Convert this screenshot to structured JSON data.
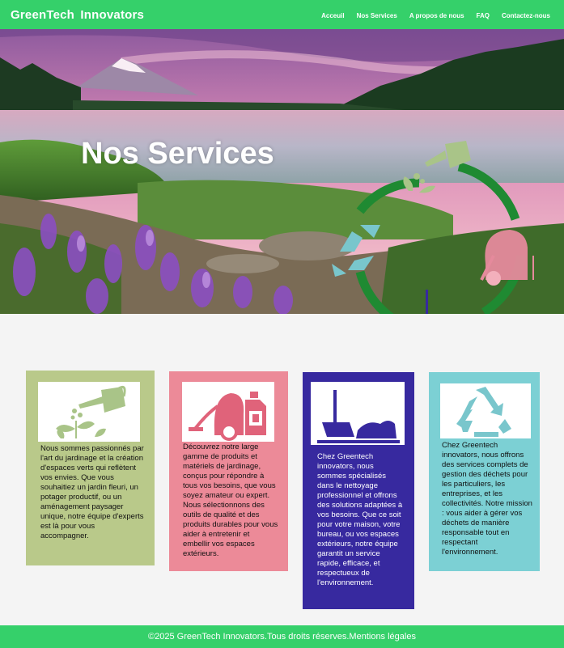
{
  "header": {
    "brand": "GreenTech  Innovators",
    "nav": [
      "Acceuil",
      "Nos Services",
      "A propos de nous",
      "FAQ",
      "Contactez-nous"
    ]
  },
  "hero": {
    "title": "Nos Services"
  },
  "cards": [
    {
      "icon": "watering-can-icon",
      "text": "Nous sommes passionnés par l'art du jardinage et la création d'espaces verts qui reflètent vos envies. Que vous souhaitiez un jardin fleuri, un potager productif, ou un aménagement paysager unique, notre équipe d'experts est là pour vous accompagner."
    },
    {
      "icon": "vacuum-cleaner-icon",
      "text": "Découvrez notre large gamme de produits et matériels de jardinage, conçus pour répondre à tous vos besoins, que vous soyez amateur ou expert. Nous sélectionnons des outils de qualité et des produits durables pour vous aider à entretenir et embellir vos espaces extérieurs."
    },
    {
      "icon": "broom-icon",
      "text": "Chez Greentech innovators, nous sommes spécialisés dans le nettoyage professionnel et offrons des solutions adaptées à vos besoins. Que ce soit pour votre maison, votre bureau, ou vos espaces extérieurs, notre équipe garantit un service rapide, efficace, et respectueux de l'environnement."
    },
    {
      "icon": "recycle-icon",
      "text": "Chez Greentech innovators, nous offrons des services complets de gestion des déchets pour les particuliers, les entreprises, et les collectivités. Notre mission : vous aider à gérer vos déchets de manière responsable tout en respectant l'environnement."
    }
  ],
  "footer": {
    "copyright": "©2025 GreenTech Innovators.",
    "rights": "Tous droits réserves.",
    "legal": "Mentions légales"
  },
  "colors": {
    "header": "#35d06a",
    "card1": "#b9c98a",
    "card2": "#ec8a98",
    "card3": "#37299f",
    "card4": "#7cd0d4"
  }
}
